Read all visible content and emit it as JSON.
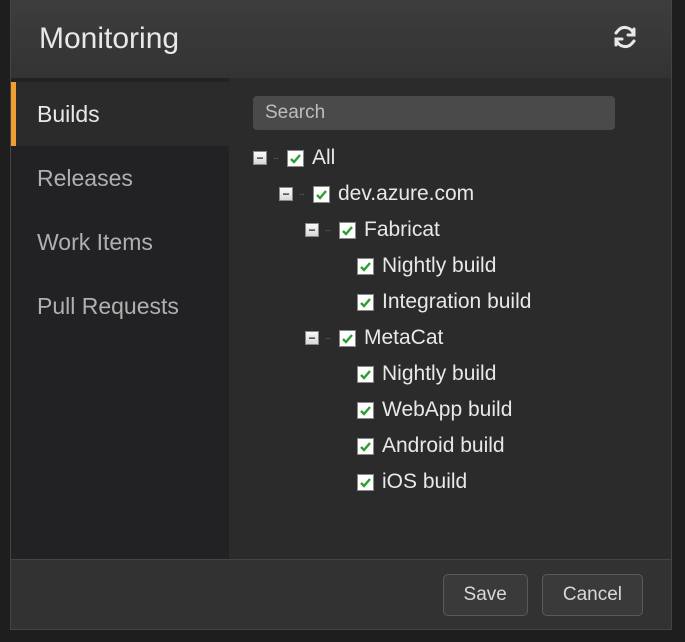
{
  "header": {
    "title": "Monitoring"
  },
  "sidebar": {
    "items": [
      {
        "label": "Builds",
        "active": true
      },
      {
        "label": "Releases",
        "active": false
      },
      {
        "label": "Work Items",
        "active": false
      },
      {
        "label": "Pull Requests",
        "active": false
      }
    ]
  },
  "search": {
    "placeholder": "Search",
    "value": ""
  },
  "tree": {
    "root": {
      "label": "All",
      "checked": true,
      "expanded": true,
      "children": [
        {
          "label": "dev.azure.com",
          "checked": true,
          "expanded": true,
          "children": [
            {
              "label": "Fabricat",
              "checked": true,
              "expanded": true,
              "children": [
                {
                  "label": "Nightly build",
                  "checked": true
                },
                {
                  "label": "Integration build",
                  "checked": true
                }
              ]
            },
            {
              "label": "MetaCat",
              "checked": true,
              "expanded": true,
              "children": [
                {
                  "label": "Nightly build",
                  "checked": true
                },
                {
                  "label": "WebApp build",
                  "checked": true
                },
                {
                  "label": "Android build",
                  "checked": true
                },
                {
                  "label": "iOS build",
                  "checked": true
                }
              ]
            }
          ]
        }
      ]
    }
  },
  "footer": {
    "save_label": "Save",
    "cancel_label": "Cancel"
  }
}
